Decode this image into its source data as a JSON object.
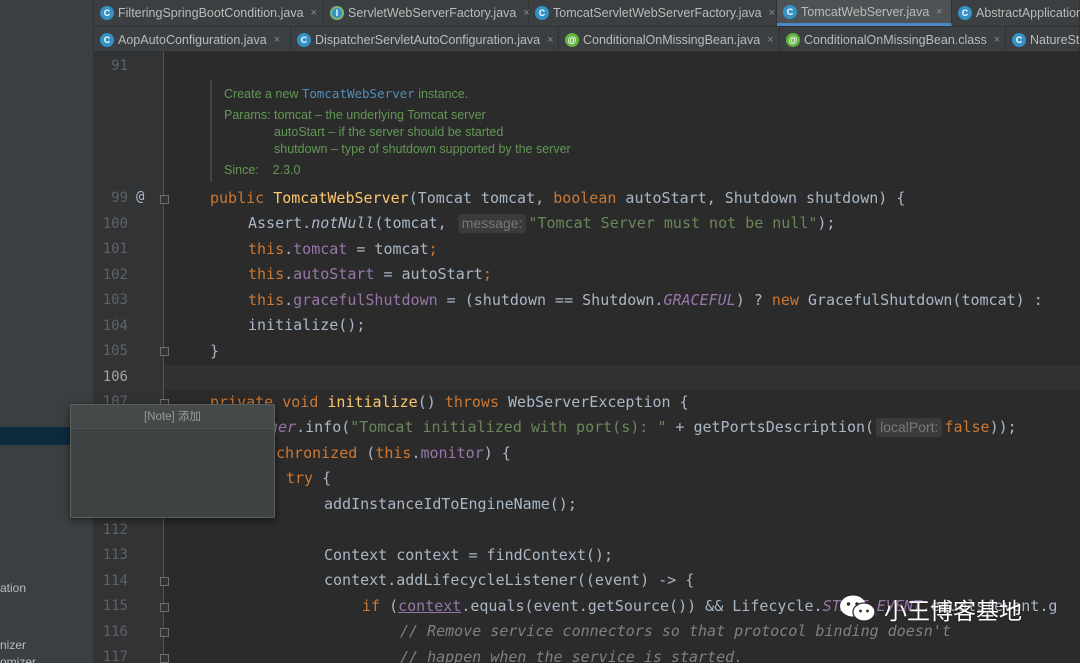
{
  "sidebar": {
    "fragments": [
      "ation",
      "nizer",
      "omizer"
    ]
  },
  "tabs": {
    "row1": [
      {
        "label": "FilteringSpringBootCondition.java",
        "icon": "class",
        "active": false
      },
      {
        "label": "ServletWebServerFactory.java",
        "icon": "interface",
        "active": false
      },
      {
        "label": "TomcatServletWebServerFactory.java",
        "icon": "class",
        "active": false
      },
      {
        "label": "TomcatWebServer.java",
        "icon": "class",
        "active": true
      },
      {
        "label": "AbstractApplicationC",
        "icon": "class",
        "active": false
      }
    ],
    "row2": [
      {
        "label": "AopAutoConfiguration.java",
        "icon": "class",
        "active": false
      },
      {
        "label": "DispatcherServletAutoConfiguration.java",
        "icon": "class",
        "active": false
      },
      {
        "label": "ConditionalOnMissingBean.java",
        "icon": "annotation",
        "active": false
      },
      {
        "label": "ConditionalOnMissingBean.class",
        "icon": "annotation",
        "active": false
      },
      {
        "label": "NatureSto",
        "icon": "class",
        "active": false
      }
    ],
    "close_glyph": "×"
  },
  "doc": {
    "summary_pre": "Create a new ",
    "summary_code": "TomcatWebServer",
    "summary_post": " instance.",
    "params_label": "Params:",
    "params": [
      "tomcat – the underlying Tomcat server",
      "autoStart – if the server should be started",
      "shutdown – type of shutdown supported by the server"
    ],
    "since_label": "Since:",
    "since_value": "2.3.0"
  },
  "gutter": {
    "line_numbers": [
      "91",
      "99",
      "100",
      "101",
      "102",
      "103",
      "104",
      "105",
      "106",
      "107",
      "112",
      "113",
      "114",
      "115",
      "116",
      "117"
    ],
    "override_marker": "@"
  },
  "code": {
    "l99": {
      "kw1": "public ",
      "ctor": "TomcatWebServer",
      "p1": "(Tomcat tomcat, ",
      "kw2": "boolean",
      "p2": " autoStart, Shutdown shutdown) {"
    },
    "l100": {
      "a": "Assert.",
      "m": "notNull",
      "b": "(tomcat, ",
      "hint": "message:",
      "s": "\"Tomcat Server must not be null\"",
      "c": ");"
    },
    "l101": {
      "kw": "this",
      "dot": ".",
      "f": "tomcat",
      "rest": " = tomcat",
      "semi": ";"
    },
    "l102": {
      "kw": "this",
      "dot": ".",
      "f": "autoStart",
      "rest": " = autoStart",
      "semi": ";"
    },
    "l103": {
      "kw": "this",
      "dot": ".",
      "f": "gracefulShutdown",
      "r1": " = (shutdown == Shutdown.",
      "c": "GRACEFUL",
      "r2": ") ? ",
      "kw2": "new",
      "r3": " GracefulShutdown(tomcat) :"
    },
    "l104": {
      "t": "initialize();"
    },
    "l105": {
      "t": "}"
    },
    "l107": {
      "kw1": "private void ",
      "fn": "initialize",
      "p": "() ",
      "kw2": "throws",
      "rest": " WebServerException {"
    },
    "l108": {
      "f": "ger",
      "a": ".info(",
      "s": "\"Tomcat initialized with port(s): \"",
      "b": " + getPortsDescription(",
      "hint": "localPort:",
      "kw": "false",
      "c": "));"
    },
    "l109": {
      "kw": "chronized",
      "a": " (",
      "kw2": "this",
      "dot": ".",
      "f": "monitor",
      "b": ") {"
    },
    "l110": {
      "kw": "try",
      "rest": " {"
    },
    "l111": {
      "t": "addInstanceIdToEngineName();"
    },
    "l113": {
      "t": "Context context = findContext();"
    },
    "l114": {
      "t": "context.addLifecycleListener((event) -> {"
    },
    "l115": {
      "kw": "if",
      "a": " (",
      "ul": "context",
      "b": ".equals(event.getSource()) && Lifecycle.",
      "c": "START_EVENT",
      "d": ".equals(event.g"
    },
    "l116": {
      "t": "// Remove service connectors so that protocol binding doesn't"
    },
    "l117": {
      "t": "// happen when the service is started."
    }
  },
  "note_popup": {
    "title": "[Note] 添加"
  },
  "watermark": {
    "text": "小王博客基地"
  }
}
